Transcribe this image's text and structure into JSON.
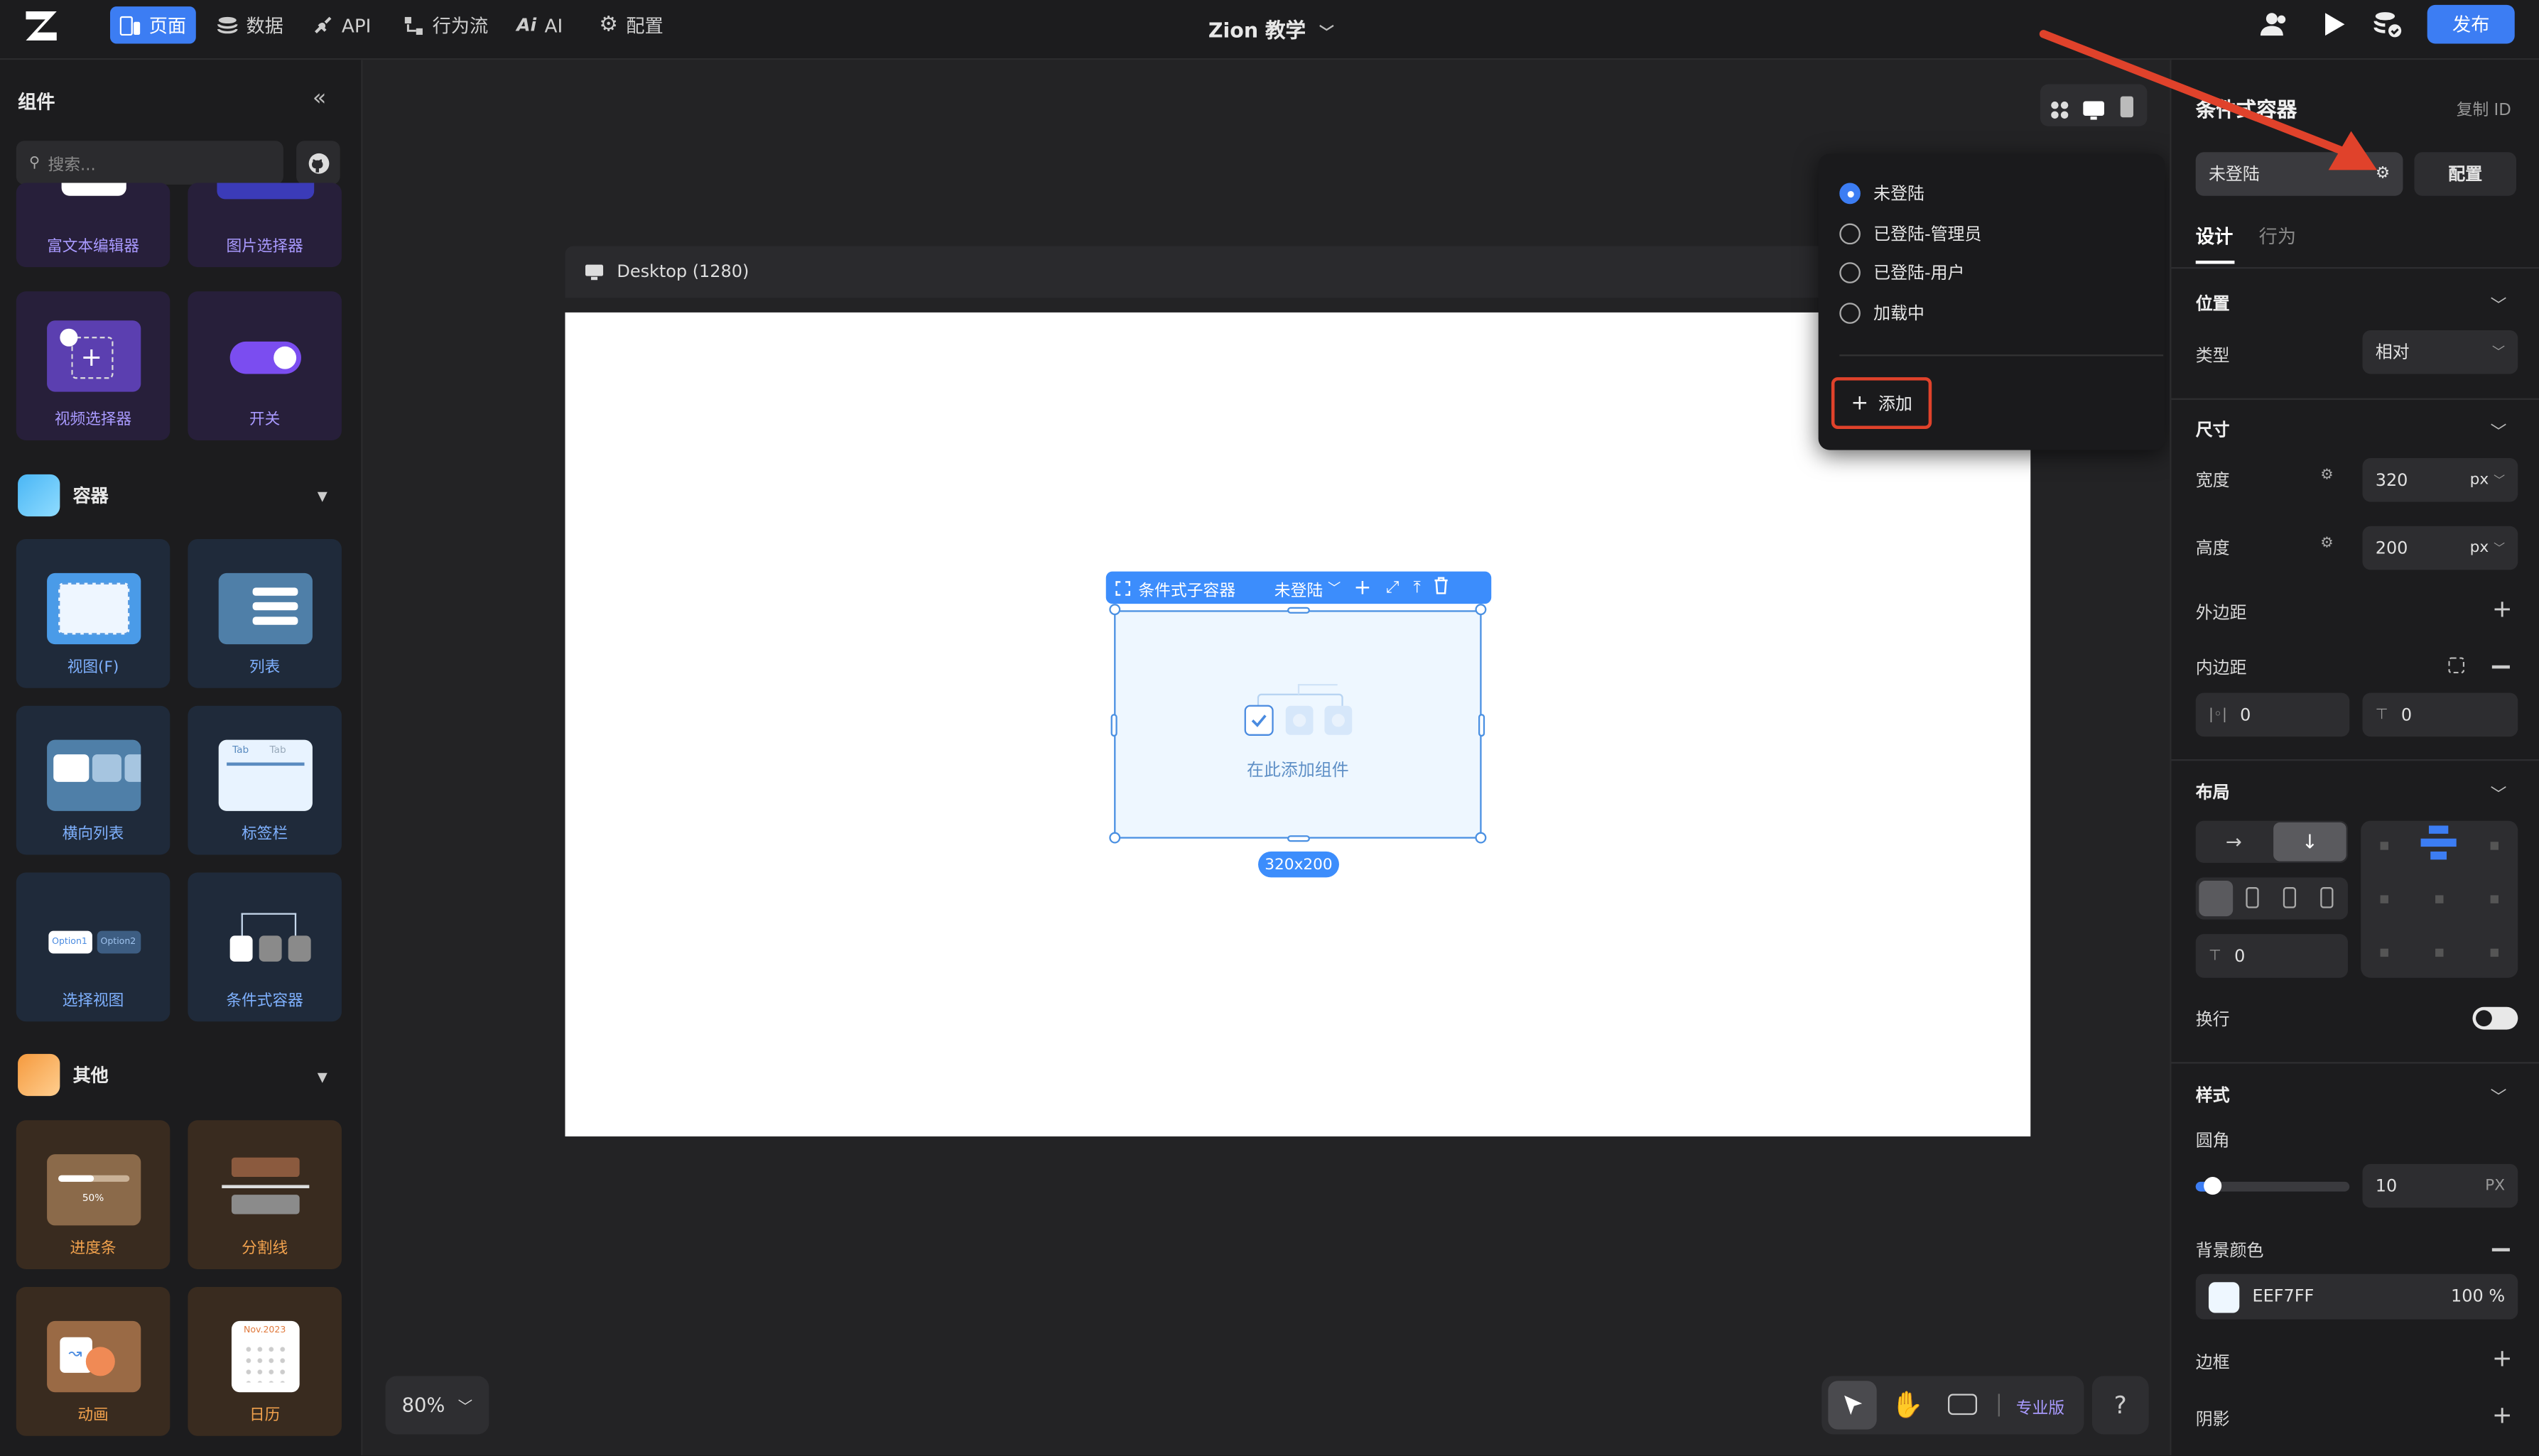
{
  "topbar": {
    "nav": [
      {
        "label": "页面",
        "icon": "page-icon",
        "active": true
      },
      {
        "label": "数据",
        "icon": "database-icon"
      },
      {
        "label": "API",
        "icon": "api-icon"
      },
      {
        "label": "行为流",
        "icon": "flow-icon"
      },
      {
        "label": "AI",
        "icon": "ai-icon"
      },
      {
        "label": "配置",
        "icon": "gear-icon"
      }
    ],
    "app_title": "Zion 教学",
    "publish_label": "发布"
  },
  "left_panel": {
    "title": "组件",
    "search_placeholder": "搜索...",
    "top_cards": [
      {
        "label": "富文本编辑器"
      },
      {
        "label": "图片选择器"
      },
      {
        "label": "视频选择器"
      },
      {
        "label": "开关"
      }
    ],
    "sections": [
      {
        "title": "容器",
        "cards": [
          {
            "label": "视图(F)"
          },
          {
            "label": "列表"
          },
          {
            "label": "横向列表"
          },
          {
            "label": "标签栏"
          },
          {
            "label": "选择视图"
          },
          {
            "label": "条件式容器"
          }
        ]
      },
      {
        "title": "其他",
        "cards": [
          {
            "label": "进度条",
            "progress": "50%"
          },
          {
            "label": "分割线"
          },
          {
            "label": "动画"
          },
          {
            "label": "日历",
            "month": "Nov.2023"
          }
        ]
      }
    ],
    "tab_mini": [
      "Tab",
      "Tab"
    ],
    "option_mini": [
      "Option1",
      "Option2"
    ]
  },
  "canvas": {
    "frame_label": "Desktop (1280)",
    "cond_toolbar": {
      "label": "条件式子容器",
      "state": "未登陆"
    },
    "placeholder": "在此添加组件",
    "size_badge": "320x200",
    "zoom": "80%",
    "mode_label": "专业版",
    "help": "?"
  },
  "state_dropdown": {
    "options": [
      {
        "label": "未登陆",
        "selected": true
      },
      {
        "label": "已登陆-管理员",
        "selected": false
      },
      {
        "label": "已登陆-用户",
        "selected": false
      },
      {
        "label": "加载中",
        "selected": false
      }
    ],
    "add_label": "添加"
  },
  "right_panel": {
    "title": "条件式容器",
    "copy_id": "复制 ID",
    "state_select": "未登陆",
    "config_label": "配置",
    "tabs": [
      "设计",
      "行为"
    ],
    "position": {
      "head": "位置",
      "type_label": "类型",
      "type_value": "相对"
    },
    "size": {
      "head": "尺寸",
      "width_label": "宽度",
      "width": "320",
      "height_label": "高度",
      "height": "200",
      "unit": "px"
    },
    "margin_label": "外边距",
    "padding": {
      "label": "内边距",
      "horizontal": "0",
      "vertical": "0"
    },
    "layout": {
      "head": "布局",
      "gap": "0",
      "wrap_label": "换行"
    },
    "style": {
      "head": "样式",
      "radius_label": "圆角",
      "radius": "10",
      "radius_unit": "PX",
      "radius_level": 0.1,
      "bg_label": "背景颜色",
      "bg_hex": "EEF7FF",
      "bg_opacity": "100 %",
      "border_label": "边框",
      "shadow_label": "阴影"
    }
  },
  "colors": {
    "accent": "#3c7df3",
    "annotation": "#e0422b",
    "container_bg": "#eef7ff"
  }
}
